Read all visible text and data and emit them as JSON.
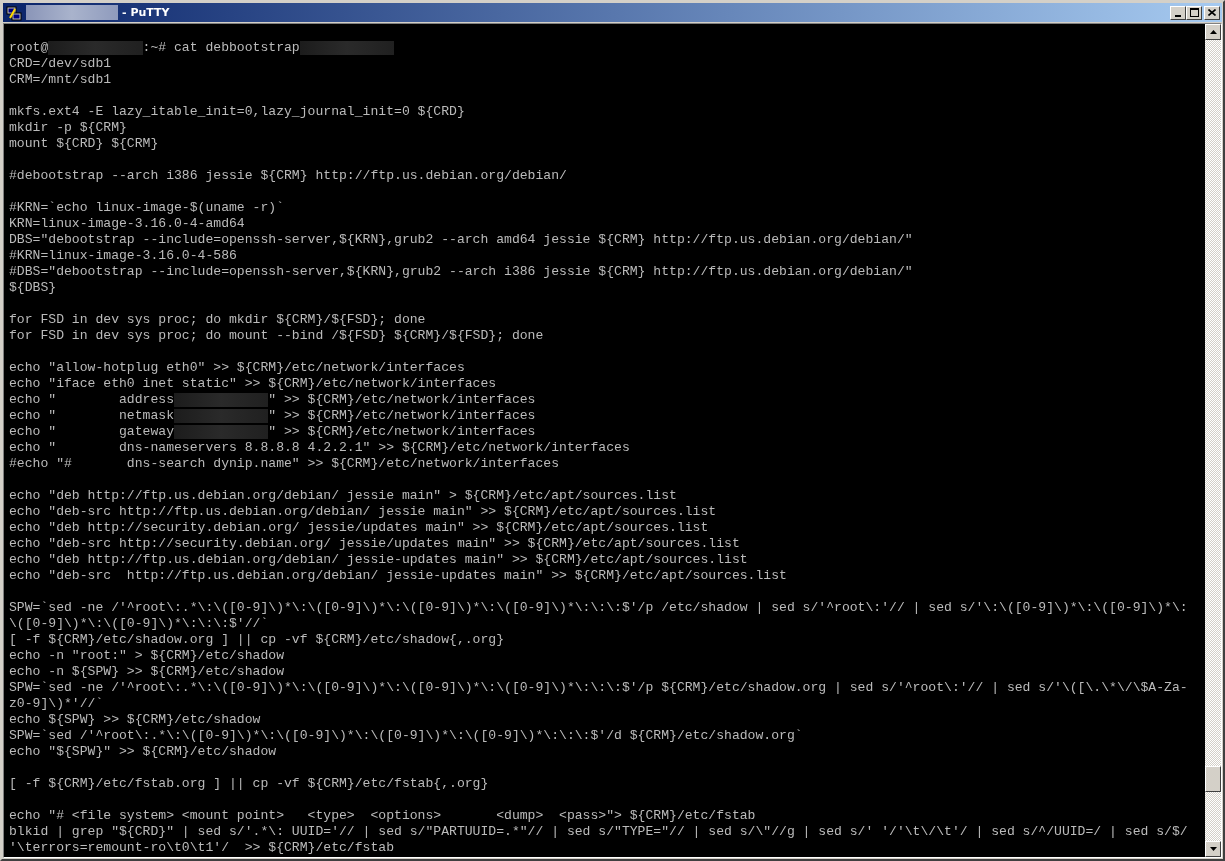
{
  "window": {
    "title": [
      {
        "kind": "redacted"
      },
      {
        "kind": "text",
        "text": "- PuTTY"
      }
    ]
  },
  "terminal": {
    "blocks": [
      [
        [
          {
            "kind": "text",
            "text": "root@"
          },
          {
            "kind": "redacted"
          },
          {
            "kind": "text",
            "text": ":~# cat debbootstrap"
          },
          {
            "kind": "redacted"
          }
        ],
        "CRD=/dev/sdb1",
        "CRM=/mnt/sdb1"
      ],
      [
        "mkfs.ext4 -E lazy_itable_init=0,lazy_journal_init=0 ${CRD}",
        "mkdir -p ${CRM}",
        "mount ${CRD} ${CRM}"
      ],
      [
        "#debootstrap --arch i386 jessie ${CRM} http://ftp.us.debian.org/debian/"
      ],
      [
        "#KRN=`echo linux-image-$(uname -r)`",
        "KRN=linux-image-3.16.0-4-amd64",
        "DBS=\"debootstrap --include=openssh-server,${KRN},grub2 --arch amd64 jessie ${CRM} http://ftp.us.debian.org/debian/\"",
        "#KRN=linux-image-3.16.0-4-586",
        "#DBS=\"debootstrap --include=openssh-server,${KRN},grub2 --arch i386 jessie ${CRM} http://ftp.us.debian.org/debian/\"",
        "${DBS}"
      ],
      [
        "for FSD in dev sys proc; do mkdir ${CRM}/${FSD}; done",
        "for FSD in dev sys proc; do mount --bind /${FSD} ${CRM}/${FSD}; done"
      ],
      [
        "echo \"allow-hotplug eth0\" >> ${CRM}/etc/network/interfaces",
        "echo \"iface eth0 inet static\" >> ${CRM}/etc/network/interfaces",
        [
          {
            "kind": "text",
            "text": "echo \"        address"
          },
          {
            "kind": "redacted"
          },
          {
            "kind": "text",
            "text": "\" >> ${CRM}/etc/network/interfaces"
          }
        ],
        [
          {
            "kind": "text",
            "text": "echo \"        netmask"
          },
          {
            "kind": "redacted"
          },
          {
            "kind": "text",
            "text": "\" >> ${CRM}/etc/network/interfaces"
          }
        ],
        [
          {
            "kind": "text",
            "text": "echo \"        gateway"
          },
          {
            "kind": "redacted"
          },
          {
            "kind": "text",
            "text": "\" >> ${CRM}/etc/network/interfaces"
          }
        ],
        "echo \"        dns-nameservers 8.8.8.8 4.2.2.1\" >> ${CRM}/etc/network/interfaces",
        "#echo \"#       dns-search dynip.name\" >> ${CRM}/etc/network/interfaces"
      ],
      [
        "echo \"deb http://ftp.us.debian.org/debian/ jessie main\" > ${CRM}/etc/apt/sources.list",
        "echo \"deb-src http://ftp.us.debian.org/debian/ jessie main\" >> ${CRM}/etc/apt/sources.list",
        "echo \"deb http://security.debian.org/ jessie/updates main\" >> ${CRM}/etc/apt/sources.list",
        "echo \"deb-src http://security.debian.org/ jessie/updates main\" >> ${CRM}/etc/apt/sources.list",
        "echo \"deb http://ftp.us.debian.org/debian/ jessie-updates main\" >> ${CRM}/etc/apt/sources.list",
        "echo \"deb-src  http://ftp.us.debian.org/debian/ jessie-updates main\" >> ${CRM}/etc/apt/sources.list"
      ],
      [
        "SPW=`sed -ne /'^root\\:.*\\:\\([0-9]\\)*\\:\\([0-9]\\)*\\:\\([0-9]\\)*\\:\\([0-9]\\)*\\:\\:\\:$'/p /etc/shadow | sed s/'^root\\:'// | sed s/'\\:\\([0-9]\\)*\\:\\([0-9]\\)*\\:",
        "\\([0-9]\\)*\\:\\([0-9]\\)*\\:\\:\\:$'//`",
        "[ -f ${CRM}/etc/shadow.org ] || cp -vf ${CRM}/etc/shadow{,.org}",
        "echo -n \"root:\" > ${CRM}/etc/shadow",
        "echo -n ${SPW} >> ${CRM}/etc/shadow",
        "SPW=`sed -ne /'^root\\:.*\\:\\([0-9]\\)*\\:\\([0-9]\\)*\\:\\([0-9]\\)*\\:\\([0-9]\\)*\\:\\:\\:$'/p ${CRM}/etc/shadow.org | sed s/'^root\\:'// | sed s/'\\([\\.\\*\\/\\$A-Za-",
        "z0-9]\\)*'//`",
        "echo ${SPW} >> ${CRM}/etc/shadow",
        "SPW=`sed /'^root\\:.*\\:\\([0-9]\\)*\\:\\([0-9]\\)*\\:\\([0-9]\\)*\\:\\([0-9]\\)*\\:\\:\\:$'/d ${CRM}/etc/shadow.org`",
        "echo \"${SPW}\" >> ${CRM}/etc/shadow"
      ],
      [
        "[ -f ${CRM}/etc/fstab.org ] || cp -vf ${CRM}/etc/fstab{,.org}"
      ],
      [
        "echo \"# <file system> <mount point>   <type>  <options>       <dump>  <pass>\"> ${CRM}/etc/fstab",
        "blkid | grep \"${CRD}\" | sed s/'.*\\: UUID='// | sed s/\"PARTUUID=.*\"// | sed s/\"TYPE=\"// | sed s/\\\"//g | sed s/' '/'\\t\\/\\t'/ | sed s/^/UUID=/ | sed s/$/",
        "'\\terrors=remount-ro\\t0\\t1'/  >> ${CRM}/etc/fstab"
      ]
    ]
  }
}
